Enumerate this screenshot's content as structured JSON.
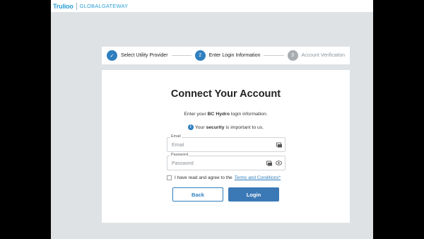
{
  "brand": {
    "logo": "Trulioo",
    "product": "GLOBALGATEWAY"
  },
  "stepper": {
    "steps": [
      {
        "number": "✓",
        "label": "Select Utility Provider",
        "state": "done"
      },
      {
        "number": "2",
        "label": "Enter Login Information",
        "state": "active"
      },
      {
        "number": "3",
        "label": "Account Verification",
        "state": "pending"
      }
    ]
  },
  "card": {
    "title": "Connect Your Account",
    "instr_prefix": "Enter your",
    "provider": "BC Hydro",
    "instr_suffix": "login information.",
    "security_prefix": "Your",
    "security_bold": "security",
    "security_suffix": "is important to us.",
    "email": {
      "label": "Email",
      "placeholder": "Email",
      "value": ""
    },
    "password": {
      "label": "Password",
      "placeholder": "Password",
      "value": ""
    },
    "agree_text": "I have read and agree to the",
    "terms_link": "Terms and Conditions*",
    "back_label": "Back",
    "login_label": "Login"
  },
  "colors": {
    "accent": "#2f7fbf",
    "pending": "#a8adb2",
    "background": "#dfe2e5"
  }
}
